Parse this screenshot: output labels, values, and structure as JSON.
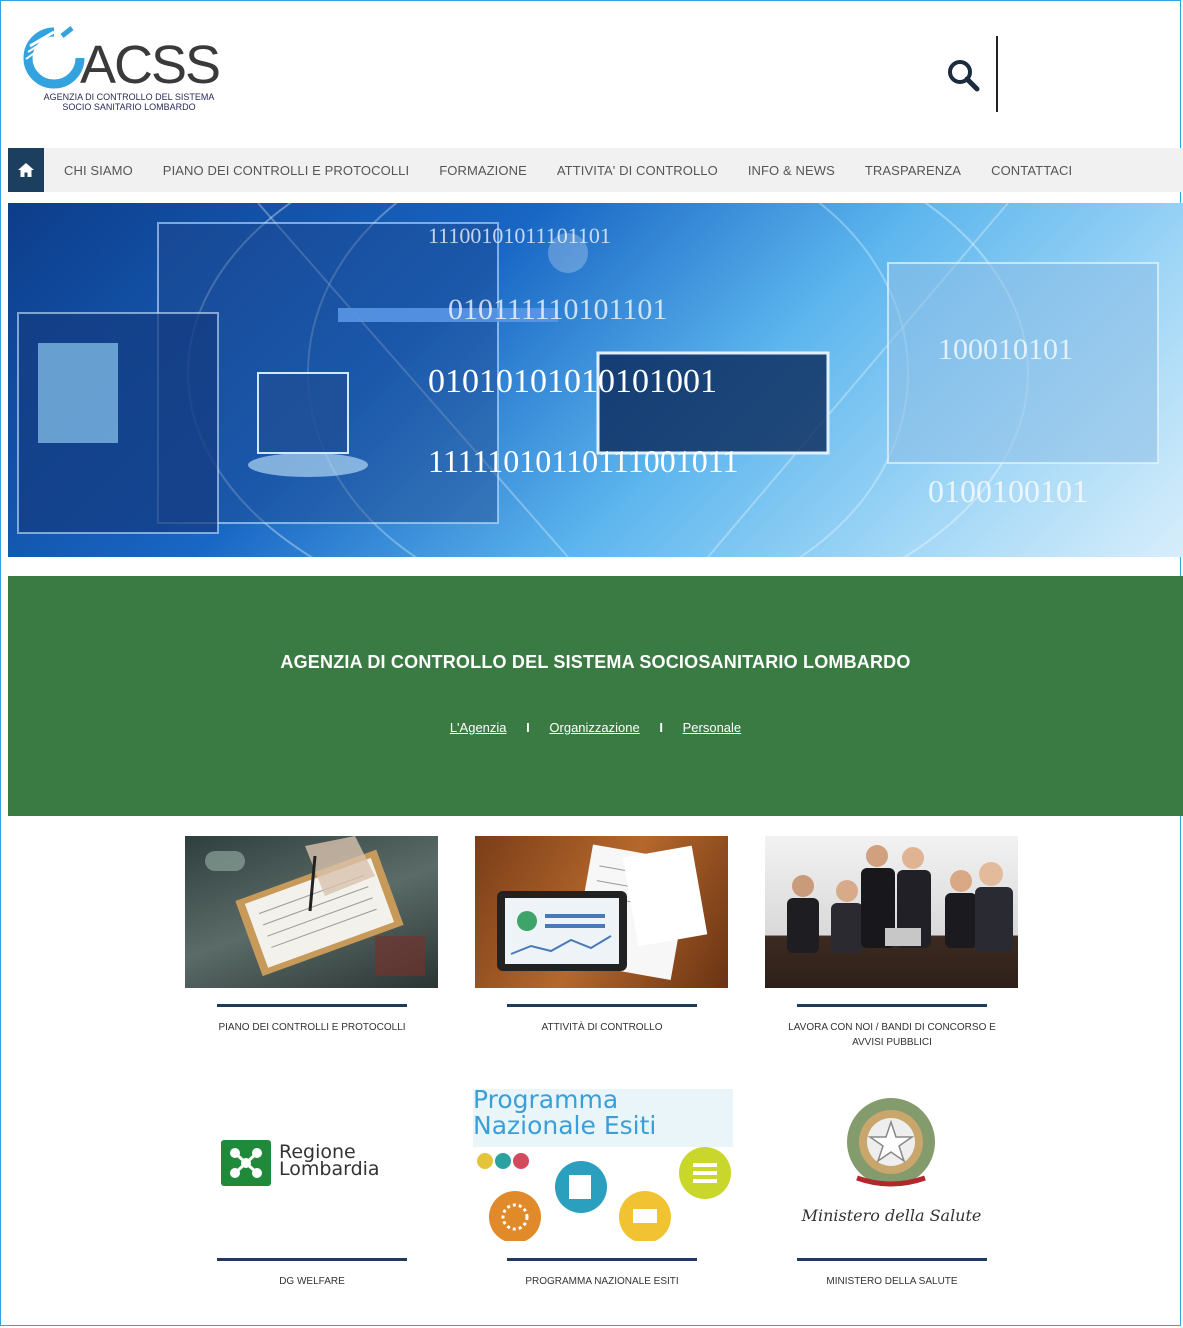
{
  "header": {
    "logo_text": "ACSS",
    "logo_subtitle_1": "AGENZIA DI CONTROLLO DEL SISTEMA",
    "logo_subtitle_2": "SOCIO SANITARIO LOMBARDO",
    "search_icon": "search-icon"
  },
  "nav": {
    "home_icon": "home-icon",
    "items": [
      "CHI SIAMO",
      "PIANO DEI CONTROLLI E PROTOCOLLI",
      "FORMAZIONE",
      "ATTIVITA' DI CONTROLLO",
      "INFO & NEWS",
      "TRASPARENZA",
      "CONTATTACI"
    ]
  },
  "band": {
    "title": "AGENZIA DI CONTROLLO DEL SISTEMA SOCIOSANITARIO LOMBARDO",
    "links": [
      "L'Agenzia",
      "Organizzazione",
      "Personale"
    ],
    "separator": "I"
  },
  "cards": [
    {
      "label": "PIANO DEI CONTROLLI E PROTOCOLLI"
    },
    {
      "label": "ATTIVITÀ DI CONTROLLO"
    },
    {
      "label": "LAVORA CON NOI / BANDI DI CONCORSO E AVVISI PUBBLICI"
    },
    {
      "label": "DG WELFARE",
      "logo_line1": "Regione",
      "logo_line2": "Lombardia"
    },
    {
      "label": "PROGRAMMA NAZIONALE ESITI",
      "logo_line1": "Programma",
      "logo_line2": "Nazionale Esiti"
    },
    {
      "label": "MINISTERO DELLA SALUTE",
      "logo_line1": "Ministero della Salute"
    }
  ],
  "colors": {
    "accent_green": "#3a7a43",
    "nav_home": "#1c3f60",
    "card_line": "#1f3a5a",
    "frame": "#33a3e0"
  }
}
